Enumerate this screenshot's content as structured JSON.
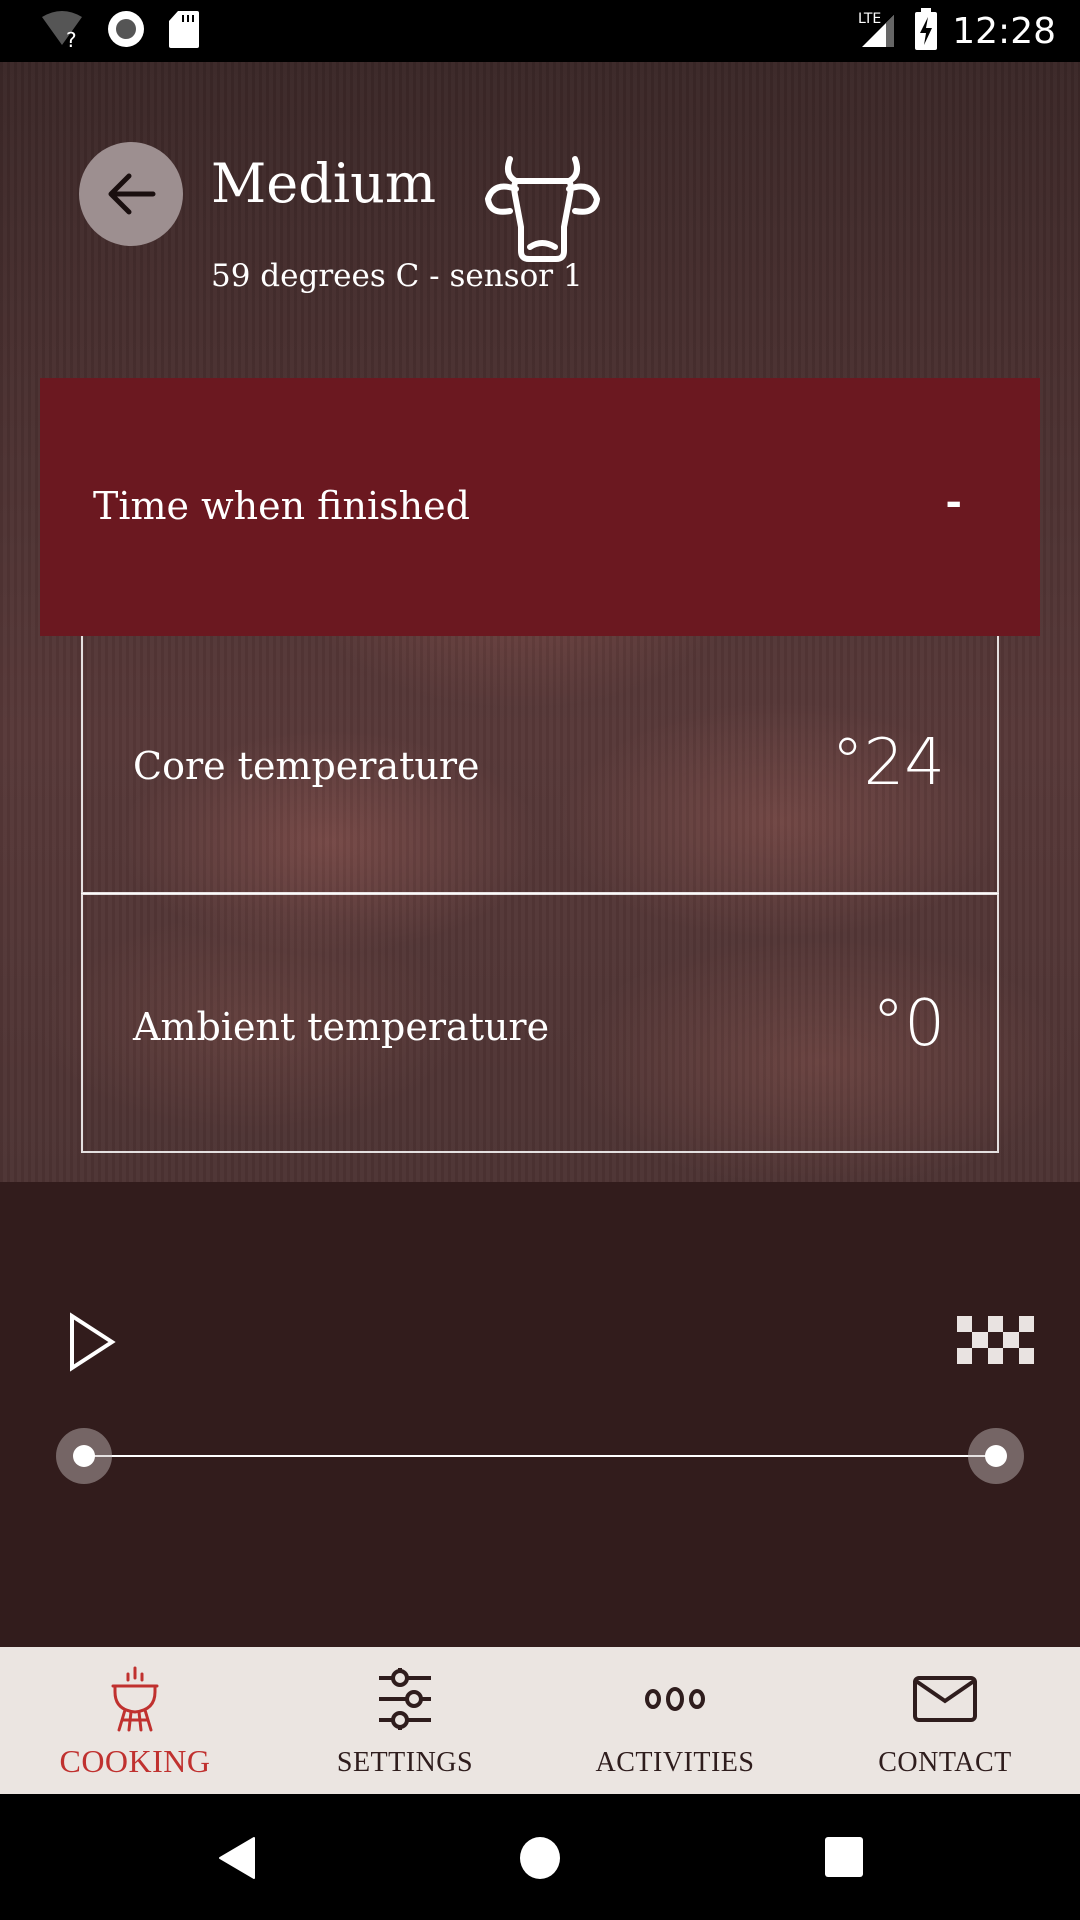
{
  "status_bar": {
    "icons_left": [
      "wifi-unknown-icon",
      "record-icon",
      "sd-card-icon"
    ],
    "network": "LTE",
    "icons_right": [
      "signal-icon",
      "battery-charging-icon"
    ],
    "time": "12:28"
  },
  "header": {
    "back_label": "Back",
    "title": "Medium",
    "animal_icon": "cow-icon",
    "subtitle": "59 degrees C - sensor 1"
  },
  "finish_panel": {
    "label": "Time when finished",
    "value": "-"
  },
  "temperatures": {
    "core": {
      "label": "Core temperature",
      "value": "°24"
    },
    "ambient": {
      "label": "Ambient temperature",
      "value": "°0"
    }
  },
  "controls": {
    "play_icon": "play-icon",
    "finish_icon": "checkered-flag-icon",
    "progress_start": 0,
    "progress_end": 100
  },
  "bottom_nav": {
    "items": [
      {
        "label": "COOKING",
        "icon": "grill-icon",
        "active": true
      },
      {
        "label": "SETTINGS",
        "icon": "sliders-icon",
        "active": false
      },
      {
        "label": "ACTIVITIES",
        "icon": "dots-icon",
        "active": false
      },
      {
        "label": "CONTACT",
        "icon": "envelope-icon",
        "active": false
      }
    ]
  },
  "colors": {
    "accent": "#c0312f",
    "panel_red": "#6b1820",
    "dark_bg": "#321c1c",
    "nav_bg": "#ebe5e1"
  }
}
